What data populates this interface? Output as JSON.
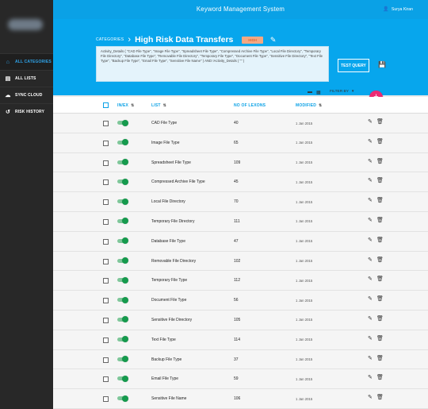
{
  "app": {
    "title": "Keyword Management System"
  },
  "user": {
    "name": "Surya Kiran",
    "icon": "user-icon"
  },
  "sidebar": {
    "items": [
      {
        "label": "ALL CATEGORIES",
        "icon": "home-icon",
        "active": true
      },
      {
        "label": "ALL LISTS",
        "icon": "list-icon",
        "active": false
      },
      {
        "label": "SYNC CLOUD",
        "icon": "cloud-icon",
        "active": false
      },
      {
        "label": "RISK HISTORY",
        "icon": "history-icon",
        "active": false
      }
    ]
  },
  "breadcrumb": {
    "parent": "CATEGORIES",
    "separator": "›",
    "title": "High Risk Data Transfers"
  },
  "badge": {
    "label": "HIGH"
  },
  "query": {
    "text": "Activity_Details ( \"CAD File Type\", \"Image File Type\", \"Spreadsheet File Type\", \"Compressed Archive File Type\", \"Local File Directory\", \"Temporary File Directory\", \"Database File Type\", \"Removable File Directory\", \"Temporary File Type\", \"Document File Type\", \"Sensitive File Directory\", \"Text File Type\", \"Backup File Type\", \"Email File Type\", \"Sensitive File Name\" ) AND !Activity_Details ( \"\" )",
    "test_button": "TEST QUERY"
  },
  "toolbar": {
    "filter_label": "FILTER BY"
  },
  "table": {
    "headers": {
      "inex": "IN/EX",
      "list": "LIST",
      "lexons": "NO OF LEXONS",
      "modified": "MODIFIED"
    },
    "rows": [
      {
        "name": "CAD File Type",
        "count": "40",
        "modified": "1 Jan 2015"
      },
      {
        "name": "Image File Type",
        "count": "65",
        "modified": "1 Jan 2015"
      },
      {
        "name": "Spreadsheet File Type",
        "count": "109",
        "modified": "1 Jan 2015"
      },
      {
        "name": "Compressed Archive File Type",
        "count": "45",
        "modified": "1 Jan 2015"
      },
      {
        "name": "Local File Directory",
        "count": "70",
        "modified": "1 Jan 2015"
      },
      {
        "name": "Temporary File Directory",
        "count": "111",
        "modified": "1 Jan 2015"
      },
      {
        "name": "Database File Type",
        "count": "47",
        "modified": "1 Jan 2015"
      },
      {
        "name": "Removable File Directory",
        "count": "102",
        "modified": "1 Jan 2015"
      },
      {
        "name": "Temporary File Type",
        "count": "112",
        "modified": "1 Jan 2015"
      },
      {
        "name": "Document File Type",
        "count": "56",
        "modified": "1 Jan 2015"
      },
      {
        "name": "Sensitive File Directory",
        "count": "105",
        "modified": "1 Jan 2015"
      },
      {
        "name": "Text File Type",
        "count": "114",
        "modified": "1 Jan 2015"
      },
      {
        "name": "Backup File Type",
        "count": "37",
        "modified": "1 Jan 2015"
      },
      {
        "name": "Email File Type",
        "count": "59",
        "modified": "1 Jan 2015"
      },
      {
        "name": "Sensitive File Name",
        "count": "106",
        "modified": "1 Jan 2015"
      }
    ]
  },
  "colors": {
    "primary": "#0aa1e6",
    "accent": "#ec2a73",
    "toggle_on": "#159a4d",
    "badge_bg": "#f3a882",
    "sidebar_bg": "#282828"
  }
}
